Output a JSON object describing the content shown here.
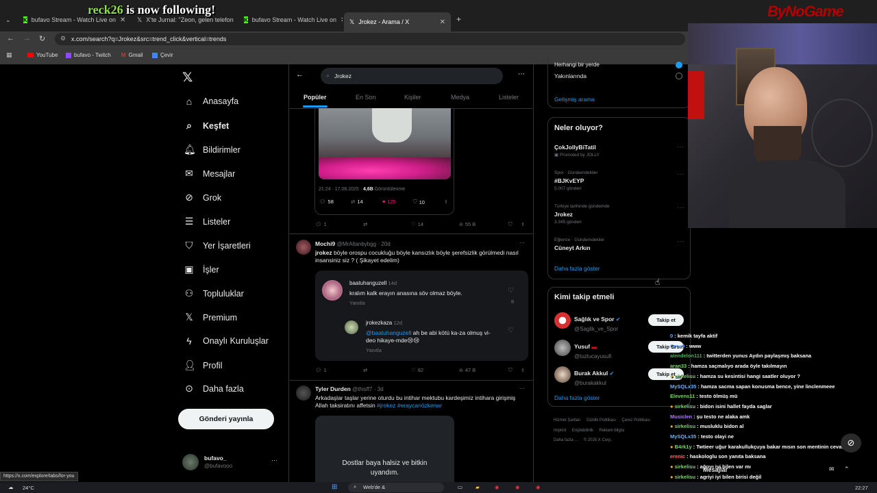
{
  "browser": {
    "tabs": [
      {
        "label": "bufavo Stream - Watch Live on",
        "icon": "kick-icon"
      },
      {
        "label": "X'te Jurnal: \"Zeon, gelen telefon",
        "icon": "x-logo-icon"
      },
      {
        "label": "bufavo Stream - Watch Live on",
        "icon": "kick-icon"
      },
      {
        "label": "Jrokez - Arama / X",
        "icon": "x-logo-icon",
        "active": true
      }
    ],
    "url": "x.com/search?q=Jrokez&src=trend_click&vertical=trends",
    "bookmarks": [
      "YouTube",
      "bufavo - Twitch",
      "Gmail",
      "Çevir"
    ],
    "status_url": "https://x.com/explore/tabs/for-you"
  },
  "overlay": {
    "follower_name": "reck26",
    "follow_text": " is now following!",
    "brand": "ByNoGame"
  },
  "sidebar": {
    "items": [
      {
        "label": "Anasayfa",
        "icon": "home-icon"
      },
      {
        "label": "Keşfet",
        "icon": "search-icon",
        "bold": true
      },
      {
        "label": "Bildirimler",
        "icon": "bell-icon"
      },
      {
        "label": "Mesajlar",
        "icon": "mail-icon"
      },
      {
        "label": "Grok",
        "icon": "grok-icon"
      },
      {
        "label": "Listeler",
        "icon": "list-icon"
      },
      {
        "label": "Yer İşaretleri",
        "icon": "bookmark-icon"
      },
      {
        "label": "İşler",
        "icon": "briefcase-icon"
      },
      {
        "label": "Topluluklar",
        "icon": "community-icon"
      },
      {
        "label": "Premium",
        "icon": "x-logo-icon"
      },
      {
        "label": "Onaylı Kuruluşlar",
        "icon": "lightning-icon"
      },
      {
        "label": "Profil",
        "icon": "user-icon"
      },
      {
        "label": "Daha fazla",
        "icon": "more-circle-icon"
      }
    ],
    "post_button": "Gönderi yayınla",
    "account": {
      "name": "bufavo_",
      "handle": "@bufavooo"
    }
  },
  "search": {
    "query": "Jrokez",
    "tabs": [
      "Popüler",
      "En Son",
      "Kişiler",
      "Medya",
      "Listeler"
    ]
  },
  "quoted_tweet": {
    "timestamp": "21:24 · 17.08.2025 · ",
    "views": "4,6B",
    "views_label": " Görüntülenme",
    "stats": {
      "replies": "58",
      "retweets": "14",
      "likes": "125",
      "bookmarks": "10"
    }
  },
  "tweet1_stats": {
    "replies": "1",
    "likes": "14",
    "views": "55 B"
  },
  "tweet2": {
    "name": "Mochi9",
    "handle": "@MrAltanbybgg",
    "time": "· 20d",
    "text_mention": "jrokez",
    "text": "   böyle orospu cocukluğu böyle kansızlık böyle şerefsizlik görülmedi nasıl insansiniz siz ? ( Şikayet edelim)",
    "replies": [
      {
        "name": "baatuhanguzell",
        "time": "14d",
        "text": "kralım kalk erayın anasına söv olmaz böyle.",
        "reply_label": "Yanıtla",
        "likes": "8"
      },
      {
        "name": "jrokezkaza",
        "time": "12d",
        "mention": "@baatuhanguzell",
        "text": " ah be abi kötü ka-za olmuş vi-deo hikaye-mde😢😢",
        "reply_label": "Yanıtla"
      }
    ],
    "stats": {
      "replies": "1",
      "likes": "82",
      "views": "47 B"
    }
  },
  "tweet3": {
    "name": "Tyler Durden",
    "handle": "@thisff7",
    "time": "· 3d",
    "text": "Arkadaşlar taşlar yerine oturdu bu intihar mektubu kardeşimiz intihara girişmiş Allah taksiratını affetsin ",
    "hashtags": "#jrokez #eraycanözkenar",
    "media_text_1": "Dostlar baya halsiz ve bitkin",
    "media_text_2": "uyandım."
  },
  "location_filter": {
    "anywhere": "Herhangi bir yerde",
    "near": "Yakınlarında",
    "advanced": "Gelişmiş arama"
  },
  "trends": {
    "title": "Neler oluyor?",
    "items": [
      {
        "meta": "",
        "name": "ÇokJollyBiTatil",
        "count": "Promoted by JOLLY"
      },
      {
        "meta": "Spor · Gündemdekiler",
        "name": "#BJKvEYP",
        "count": "5.007 gönderi"
      },
      {
        "meta": "Türkiye tarihinde gündemde",
        "name": "Jrokez",
        "count": "3.345 gönderi"
      },
      {
        "meta": "Eğlence · Gündemdekiler",
        "name": "Cüneyt Arkın",
        "count": ""
      }
    ],
    "show_more": "Daha fazla göster"
  },
  "who_to_follow": {
    "title": "Kimi takip etmeli",
    "users": [
      {
        "name": "Sağlık ve Spor",
        "handle": "@Saglik_ve_Spor",
        "button": "Takip et"
      },
      {
        "name": "Yusuf",
        "handle": "@tuzlucayusufi",
        "button": "Takip et"
      },
      {
        "name": "Burak Akkul",
        "handle": "@burakakkul",
        "button": "Takip et"
      }
    ],
    "show_more": "Daha fazla göster"
  },
  "footer": {
    "links": [
      "Hizmet Şartları",
      "Gizlilik Politikası",
      "Çerez Politikası",
      "Imprint",
      "Erişilebilirlik",
      "Reklam bilgisi",
      "Daha fazla ...",
      "© 2025 X Corp."
    ]
  },
  "chat": [
    {
      "user": "0",
      "text": ": kemik tayfa aktif",
      "color": "#6ab0ff"
    },
    {
      "user": "Crox0",
      "text": ": www",
      "color": "#6ab0ff"
    },
    {
      "user": "alendelon111",
      "text": ": twitterden yunus Aydın paylaşmış baksana",
      "color": "#4caf50"
    },
    {
      "user": "aran33",
      "text": ": hamza saçmalıyo arada öyle takılmayın",
      "color": "#7bd66a"
    },
    {
      "user": "sirkelisu",
      "text": ": hamza su kesintisi hangi saatler oluyor ?",
      "color": "#7bd66a",
      "badge": true
    },
    {
      "user": "MySQLx35",
      "text": ": hamza sacma sapan konusma bence, yine linclenmeee",
      "color": "#6ab0ff"
    },
    {
      "user": "Elevens11",
      "text": ": testo ölmüş mü",
      "color": "#7bd66a"
    },
    {
      "user": "sirkelisu",
      "text": ": bidon isini hallet fayda saglar",
      "color": "#7bd66a",
      "badge": true
    },
    {
      "user": "Musiclen",
      "text": ": şu testo ne alaka amk",
      "color": "#b57bff"
    },
    {
      "user": "sirkelisu",
      "text": ": musluklu bidon al",
      "color": "#7bd66a",
      "badge": true
    },
    {
      "user": "MySQLx35",
      "text": ": testo olayi ne",
      "color": "#6ab0ff"
    },
    {
      "user": "B4rk1y",
      "text": ": Twtieer uğur karakullukçuya bakar mısın son mentinin cevabına",
      "color": "#7bd66a",
      "badge": true
    },
    {
      "user": "erenic",
      "text": ": haskologlu son yanıta baksana",
      "color": "#ff6a6a"
    },
    {
      "user": "sirkelisu",
      "text": ": ağrıyı iyi bilen var mı",
      "color": "#7bd66a",
      "badge": true
    },
    {
      "user": "sirkelisu",
      "text": ": agriyi iyi bilen birisi değil",
      "color": "#7bd66a",
      "badge": true
    },
    {
      "user": "merthe_24",
      "text": ": haskologlu yalan atacak birisi değil",
      "color": "#7bd66a"
    }
  ],
  "chat_overlay_label": "Mesajlar",
  "taskbar": {
    "weather": "24°C",
    "search": "Web'de &",
    "time": "22:27"
  }
}
